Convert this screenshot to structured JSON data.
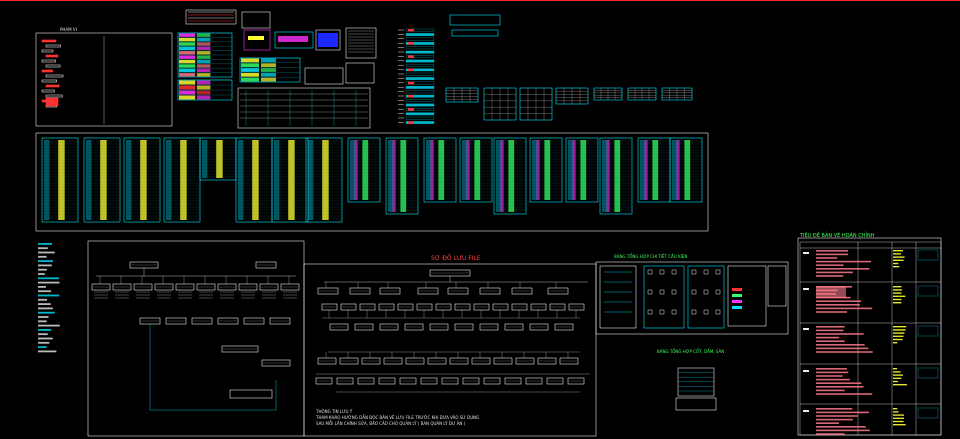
{
  "drawing": {
    "title_tree": "SƠ ĐỒ LƯU FILE",
    "title_detail": "BẢNG TỔNG HỢP CHI TIẾT CẦU KIỆN",
    "title_sheet": "TIÊU ĐỀ BẢN VẼ HOÀN CHỈNH",
    "title_composite": "BẢNG TỔNG HỢP CỐT, DẦM, SÀN",
    "note_line1": "THÔNG TIN LƯU Ý",
    "note_line2": "THAM KHẢO HƯỚNG DẪN ĐỌC BẢN VẼ LƯU FILE TRƯỚC KHI ĐƯA VÀO SỬ DỤNG",
    "note_line3": "SAU MỖI LẦN CHỈNH SỬA, BÁO CÁO CHO QUẢN LÝ ( BAN QUẢN LÝ DỰ ÁN )",
    "cad_label": "PHAM VI"
  },
  "colors": {
    "background": "#000000",
    "frame": "#ff2a2a",
    "line": "#e8e8e8",
    "cyan": "#00e5ff",
    "yellow": "#ffff33",
    "green": "#33ff66",
    "magenta": "#ff33ff",
    "red": "#ff3333",
    "pink": "#ff7a8a"
  }
}
